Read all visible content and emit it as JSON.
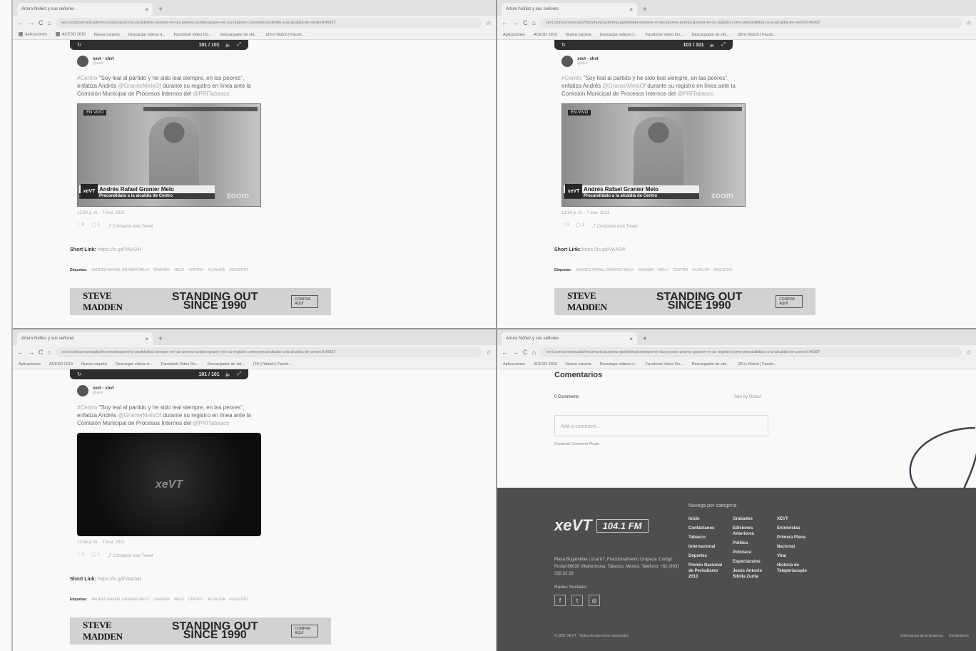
{
  "browser": {
    "tab_title": "Arturo Núñez y sus señores",
    "tab_close": "×",
    "new_tab": "+",
    "nav_back": "←",
    "nav_forward": "→",
    "nav_reload": "C",
    "nav_home": "⌂",
    "url": "xevt.com/comunicado/imcomunicacion/nu-partidoleal-siempre-en-las-peores-andres-granier-en-su-registro-como-precandidato-a-la-alcaldia-de-centro/140837",
    "bookmarks": [
      "Aplicaciones",
      "ACESO 2019",
      "Nueva carpeta",
      "Descargar videos d...",
      "Facebook Video Do...",
      "Descargador de vid...",
      "(20+) Watch | Faceb..."
    ]
  },
  "tweet": {
    "video_time": "101 / 101",
    "account": "xevt - xhvt",
    "account_handle": "@xevt",
    "text_prefix": "#Centro ",
    "text_body": "\"Soy leal al partido y he sido leal siempre, en las peores\", enfatiza Andrés ",
    "mention": "@GranierMeloOf",
    "text_tail": " durante su registro en línea ante la Comisión Municipal de Procesos Internos del ",
    "mention2": "@PRITabasco",
    "timestamp": "12:54 p. m. · 7 mar. 2021",
    "actions": [
      "♡ 0",
      "◯ 1",
      "⤴ Comparte este Tweet"
    ],
    "media": {
      "name": "Andrés Rafael Granier Melo",
      "role": "Precandidato a la alcaldía de Centro",
      "logo": "xeVT",
      "watermark": "zoom",
      "live": "EN VIVO"
    }
  },
  "article": {
    "short_link_label": "Short Link:",
    "short_link_url": "https://is.gd/VAA34I",
    "tags_label": "Etiquetas:",
    "tags": [
      "ANDRÉS RAFAEL GRANIER MELO",
      "GRANIER",
      "MELO",
      "CENTRO",
      "ALCALDÍA",
      "REGISTRO"
    ],
    "ad": {
      "brand": "STEVE MADDEN",
      "tagline": "STANDING OUT SINCE 1990",
      "cta": "COMPRA AQUÍ"
    }
  },
  "comments": {
    "title": "Comentarios",
    "count": "0 Comments",
    "sort_label": "Sort by",
    "sort_value": "Oldest",
    "placeholder": "Add a comment...",
    "plugin": "Facebook Comments Plugin"
  },
  "footer": {
    "logo": "xeVT",
    "frequency": "104.1 FM",
    "address": "Plaza Bugambilia Local 87, Fraccionamiento Oropeza. Código Postal 86030 Villahermosa, Tabasco, México. Teléfono: +52 (993) 315 32 33",
    "social_label": "Redes Sociales",
    "social": [
      "f",
      "t",
      "◎"
    ],
    "nav_title": "Navega por categoría",
    "col1": [
      "Inicio",
      "Contáctanos",
      "Tabasco",
      "Internacional",
      "Deportes",
      "Premio Nacional de Periodismo 2013"
    ],
    "col2": [
      "Grabados",
      "Ediciones Anteriores",
      "Política",
      "Policiaca",
      "Espectáculos",
      "Jesús Antonio Sibilla Zurita"
    ],
    "col3": [
      "XEVT",
      "Entrevistas",
      "Primera Plana",
      "Nacional",
      "Viral",
      "Historia de Teleperiscopio"
    ],
    "copyright": "© 2021 XEVT · Todos los derechos reservados",
    "links": [
      "Informacion de la Empresa",
      "Contactanos"
    ]
  }
}
